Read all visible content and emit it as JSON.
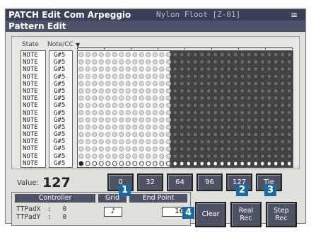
{
  "titlebar": {
    "title": "PATCH Edit Com Arpeggio",
    "patch_name": "Nylon Floot  [Z-01]",
    "menu_icon": "menu-icon"
  },
  "screen_title": "Pattern Edit",
  "columns": {
    "state": "State",
    "note": "Note/CC"
  },
  "rows": {
    "state": [
      "NOTE",
      "NOTE",
      "NOTE",
      "NOTE",
      "NOTE",
      "NOTE",
      "NOTE",
      "NOTE",
      "NOTE",
      "NOTE",
      "NOTE",
      "NOTE",
      "NOTE",
      "NOTE",
      "NOTE",
      "NOTE"
    ],
    "note": [
      "G#5",
      "G#5",
      "G#5",
      "G#5",
      "G#5",
      "G#5",
      "G#5",
      "G#5",
      "G#5",
      "G#5",
      "G#5",
      "G#5",
      "G#5",
      "G#5",
      "G#5",
      "G#5"
    ]
  },
  "value": {
    "label": "Value:",
    "number": "127"
  },
  "quick_values": [
    "0",
    "32",
    "64",
    "96",
    "127",
    "Tie"
  ],
  "controller": {
    "header": "Controller",
    "rows": [
      {
        "name": "TTPadX",
        "sep": ":",
        "value": "0"
      },
      {
        "name": "TTPadY",
        "sep": ":",
        "value": "0"
      }
    ]
  },
  "grid_setting": {
    "header": "Grid",
    "value": "♪"
  },
  "end_point": {
    "header": "End Point",
    "value": "16"
  },
  "buttons": {
    "clear": "Clear",
    "real_rec": [
      "Real",
      "Rec"
    ],
    "step_rec": [
      "Step",
      "Rec"
    ]
  },
  "badges": [
    "1",
    "2",
    "3",
    "4"
  ],
  "colors": {
    "title_bar": "#3a3f55",
    "button": "#4d5264",
    "badge": "#1a6aa0"
  }
}
